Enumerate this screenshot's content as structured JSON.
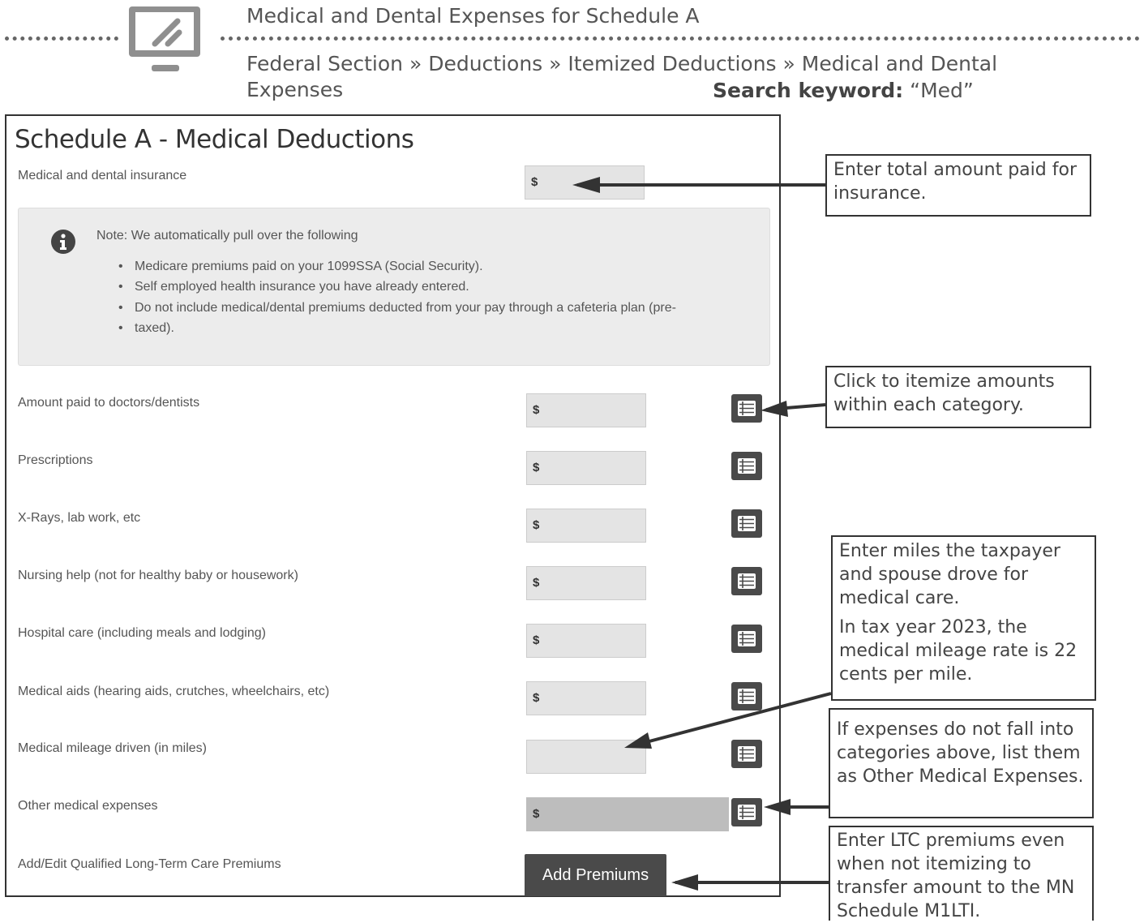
{
  "header": {
    "title": "Medical and Dental Expenses for Schedule A",
    "breadcrumb_line1": "Federal Section » Deductions » Itemized Deductions » Medical and Dental",
    "breadcrumb_line2": "Expenses",
    "search_keyword_label": "Search keyword:",
    "search_keyword_value": "“Med”",
    "icon": "computer-monitor-icon"
  },
  "form": {
    "title": "Schedule A - Medical Deductions",
    "insurance_label": "Medical and dental insurance",
    "currency": "$",
    "note": {
      "heading": "Note: We automatically pull over the following",
      "items": [
        "Medicare premiums paid on your 1099SSA (Social Security).",
        "Self employed health insurance you have already entered.",
        "Do not include medical/dental premiums deducted from your pay through a cafeteria plan (pre-",
        "taxed)."
      ],
      "icon": "info-icon"
    },
    "rows": [
      {
        "label": "Amount paid to doctors/dentists"
      },
      {
        "label": "Prescriptions"
      },
      {
        "label": "X-Rays, lab work, etc"
      },
      {
        "label": "Nursing help (not for healthy baby or housework)"
      },
      {
        "label": "Hospital care (including meals and lodging)"
      },
      {
        "label": "Medical aids (hearing aids, crutches, wheelchairs, etc)"
      },
      {
        "label": "Medical mileage driven (in miles)"
      },
      {
        "label": "Other medical expenses"
      }
    ],
    "ltc_label": "Add/Edit Qualified Long-Term Care Premiums",
    "add_premiums_button": "Add Premiums",
    "itemize_icon": "list-icon"
  },
  "callouts": {
    "insurance": "Enter total amount paid for insurance.",
    "itemize": "Click to itemize amounts within each category.",
    "mileage_1": "Enter miles the taxpayer and spouse drove for medical care.",
    "mileage_2": "In tax year 2023, the medical mileage rate is 22 cents per mile.",
    "other": "If expenses do not fall into categories above, list them as Other Medical Expenses.",
    "ltc": "Enter LTC premiums even when not itemizing to transfer amount to the MN Schedule M1LTI."
  },
  "colors": {
    "button_dark": "#4a4a4a",
    "input_bg": "#e4e4e4",
    "note_bg": "#ececec"
  }
}
